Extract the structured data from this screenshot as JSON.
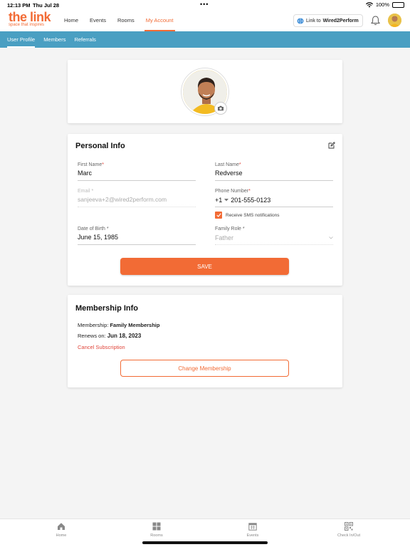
{
  "status_bar": {
    "time": "12:13 PM",
    "date": "Thu Jul 28",
    "battery": "100%"
  },
  "header": {
    "logo_main": "the link",
    "logo_sub": "space that inspires",
    "nav": [
      "Home",
      "Events",
      "Rooms",
      "My Account"
    ],
    "active_nav": "My Account",
    "link_button_prefix": "Link to",
    "link_button_bold": "Wired2Perform"
  },
  "subtabs": {
    "items": [
      "User Profile",
      "Members",
      "Referrals"
    ],
    "active": "User Profile"
  },
  "personal_info": {
    "title": "Personal Info",
    "first_name_label": "First Name",
    "first_name": "Marc",
    "last_name_label": "Last Name",
    "last_name": "Redverse",
    "email_label": "Email",
    "email": "sanjeeva+2@wired2perform.com",
    "phone_label": "Phone Number",
    "phone_code": "+1",
    "phone": "201-555-0123",
    "sms_label": "Receive SMS notifications",
    "sms_checked": true,
    "dob_label": "Date of Birth",
    "dob": "June 15, 1985",
    "family_role_label": "Family Role",
    "family_role": "Father",
    "save_label": "SAVE"
  },
  "membership_info": {
    "title": "Membership Info",
    "membership_prefix": "Membership:",
    "membership": "Family Membership",
    "renews_prefix": "Renews on:",
    "renews": "Jun 18, 2023",
    "cancel_label": "Cancel Subscription",
    "change_label": "Change Membership"
  },
  "tabbar": [
    "Home",
    "Rooms",
    "Events",
    "Check In/Out"
  ],
  "colors": {
    "accent": "#f26b35",
    "subtab_bar": "#4a9fc2",
    "required": "#e0453a"
  }
}
